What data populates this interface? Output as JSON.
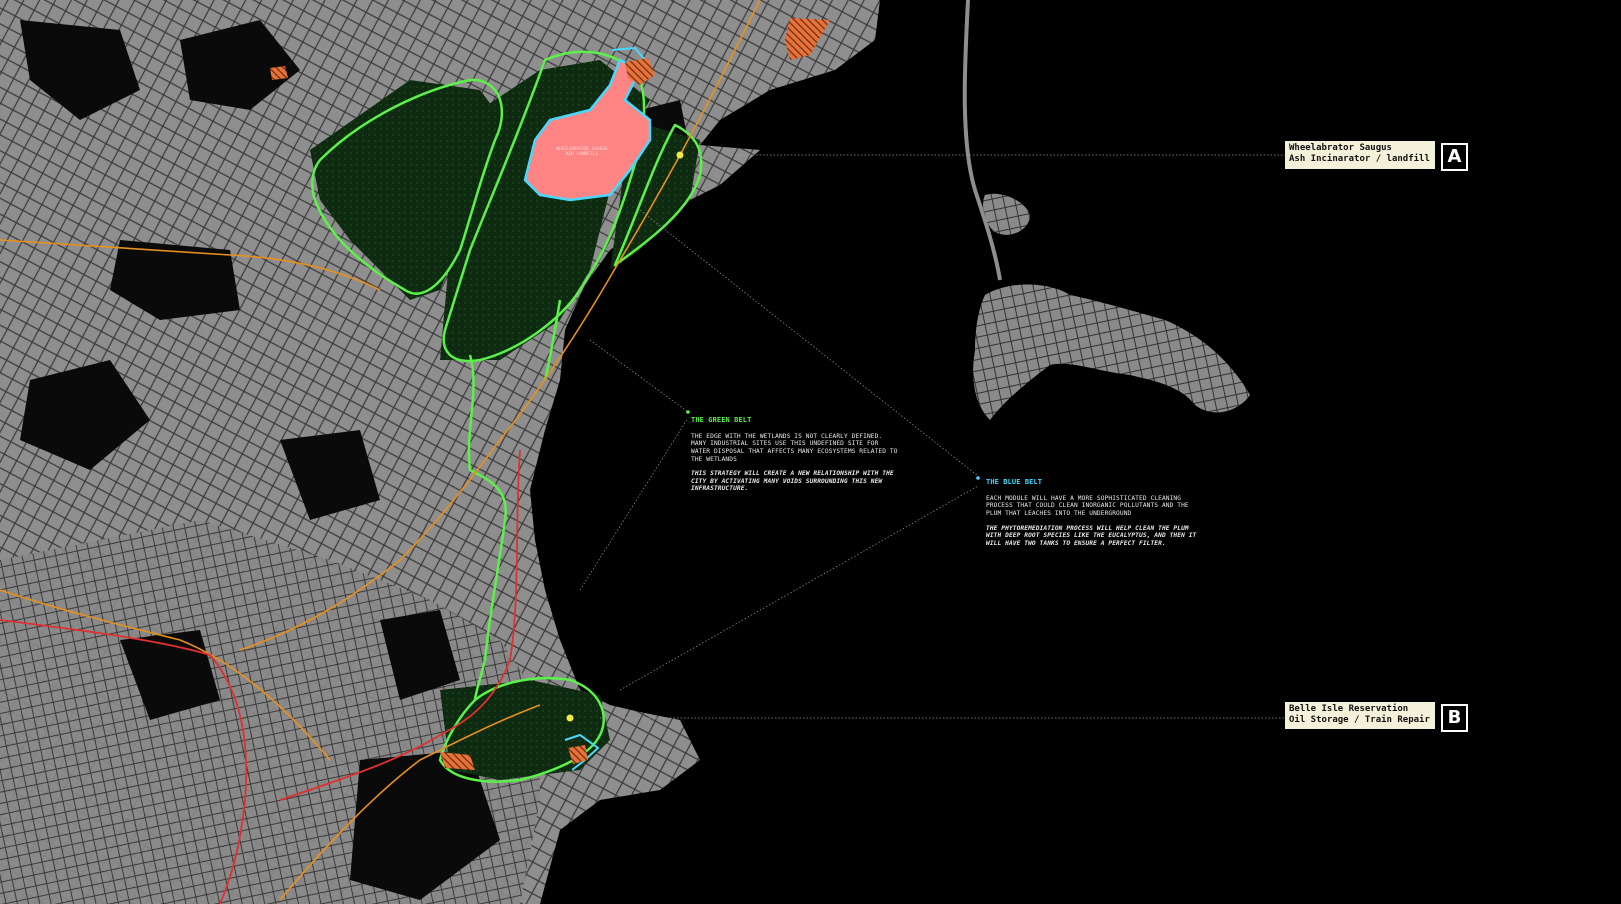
{
  "callouts": {
    "a": {
      "line1": "Wheelabrator Saugus",
      "line2": "Ash Incinarator / landfill",
      "letter": "A"
    },
    "b": {
      "line1": "Belle Isle Reservation",
      "line2": "Oil Storage / Train Repair",
      "letter": "B"
    }
  },
  "notes": {
    "green": {
      "title": "THE GREEN BELT",
      "body": "THE EDGE WITH THE WETLANDS IS NOT CLEARLY DEFINED. MANY INDUSTRIAL SITES USE THIS UNDEFINED SITE FOR WATER DISPOSAL THAT AFFECTS MANY ECOSYSTEMS RELATED TO THE WETLANDS",
      "emphasis": "THIS STRATEGY WILL CREATE A NEW RELATIONSHIP WITH THE CITY BY ACTIVATING MANY VOIDS SURROUNDING THIS NEW INFRASTRUCTURE."
    },
    "blue": {
      "title": "THE BLUE BELT",
      "body": "EACH MODULE WILL HAVE A MORE SOPHISTICATED CLEANING PROCESS THAT COULD CLEAN INORGANIC POLLUTANTS AND THE PLUM THAT LEACHES INTO THE UNDERGROUND",
      "emphasis": "THE PHYTOREMEDIATION PROCESS WILL HELP CLEAN THE PLUM WITH DEEP ROOT SPECIES LIKE THE EUCALYPTUS, AND THEN IT WILL HAVE TWO TANKS TO ENSURE A PERFECT FILTER."
    }
  },
  "landfill_label": "WHEELABRATOR SAUGUS ASH LANDFILL",
  "colors": {
    "background": "#000000",
    "land": "#8e8e8e",
    "green_belt": "#5cf04a",
    "wetland_fill": "#0e2a10",
    "blue_belt": "#48d8ff",
    "landfill": "#ff8585",
    "industrial": "#e8733a",
    "highway": "#e8901c",
    "rail": "#e03030",
    "callout_bg": "#f4f1da"
  },
  "map": {
    "layers": [
      "land",
      "streets",
      "wetlands",
      "green-belt",
      "blue-belt",
      "landfill",
      "industrial-sites",
      "highways",
      "rail",
      "leader-lines"
    ]
  }
}
